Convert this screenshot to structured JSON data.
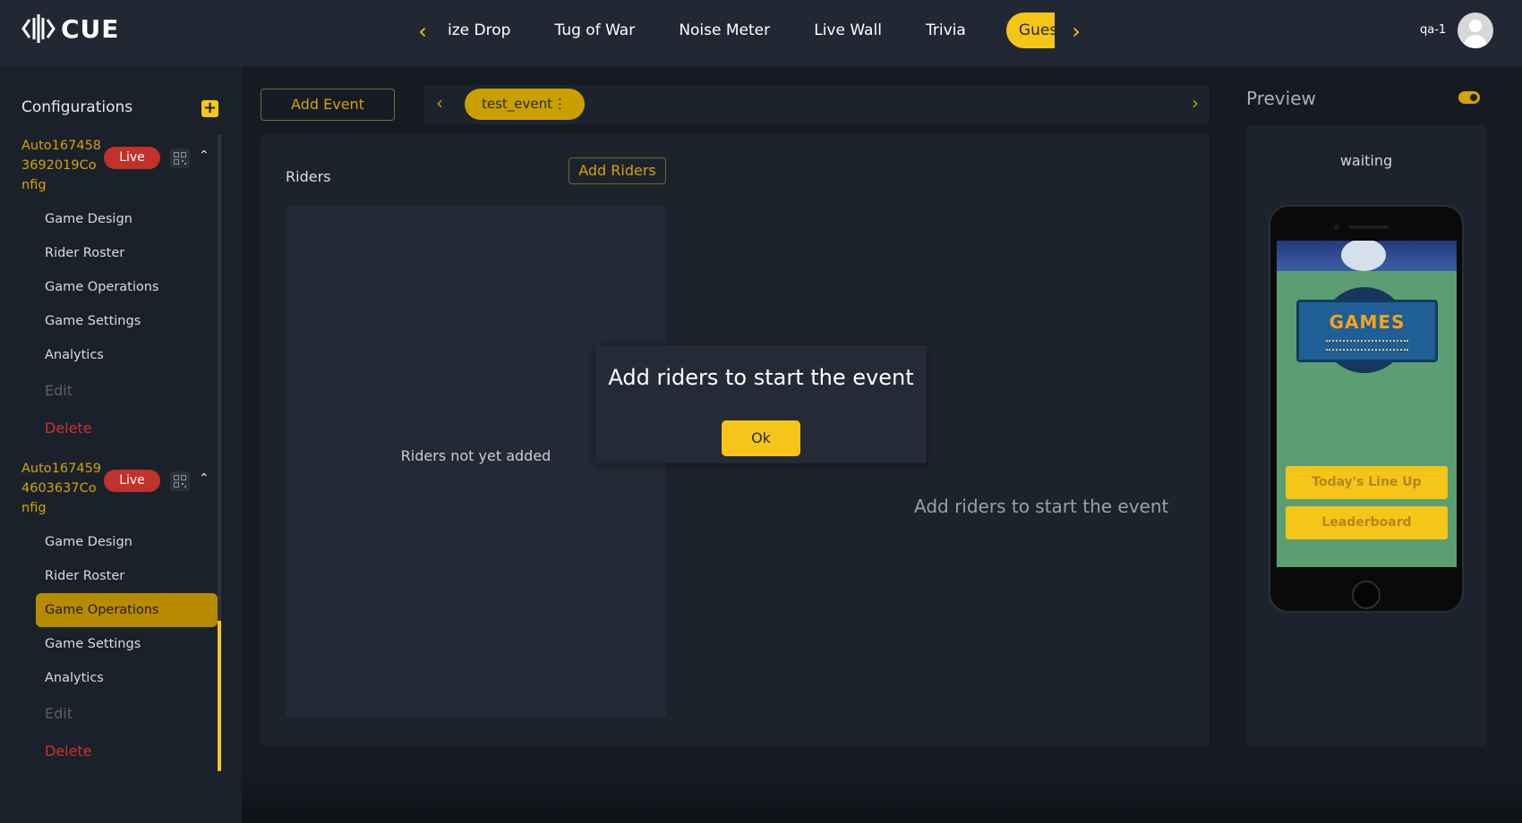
{
  "header": {
    "logo_text": "CUE",
    "tabs": [
      {
        "label": "ize Drop"
      },
      {
        "label": "Tug of War"
      },
      {
        "label": "Noise Meter"
      },
      {
        "label": "Live Wall"
      },
      {
        "label": "Trivia"
      },
      {
        "label": "Guess The Score"
      }
    ],
    "active_tab": "Guess The Score",
    "username": "qa-1",
    "accent_color": "#f5c518"
  },
  "sidebar": {
    "title": "Configurations",
    "configs": [
      {
        "name": "Auto1674583692019Config",
        "status": "Live",
        "menu": [
          "Game Design",
          "Rider Roster",
          "Game Operations",
          "Game Settings",
          "Analytics",
          "Edit",
          "Delete"
        ]
      },
      {
        "name": "Auto1674594603637Config",
        "status": "Live",
        "menu": [
          "Game Design",
          "Rider Roster",
          "Game Operations",
          "Game Settings",
          "Analytics",
          "Edit",
          "Delete"
        ],
        "active_item": "Game Operations"
      }
    ]
  },
  "main": {
    "add_event_label": "Add Event",
    "event_chip": "test_event",
    "riders_title": "Riders",
    "add_riders_label": "Add Riders",
    "riders_empty": "Riders not yet added",
    "start_hint": "Add riders to start the event"
  },
  "preview": {
    "title": "Preview",
    "status": "waiting",
    "screen_logo": "GAMES",
    "buttons": [
      "Today's Line Up",
      "Leaderboard"
    ]
  },
  "modal": {
    "message": "Add riders to start the event",
    "ok_label": "Ok"
  }
}
